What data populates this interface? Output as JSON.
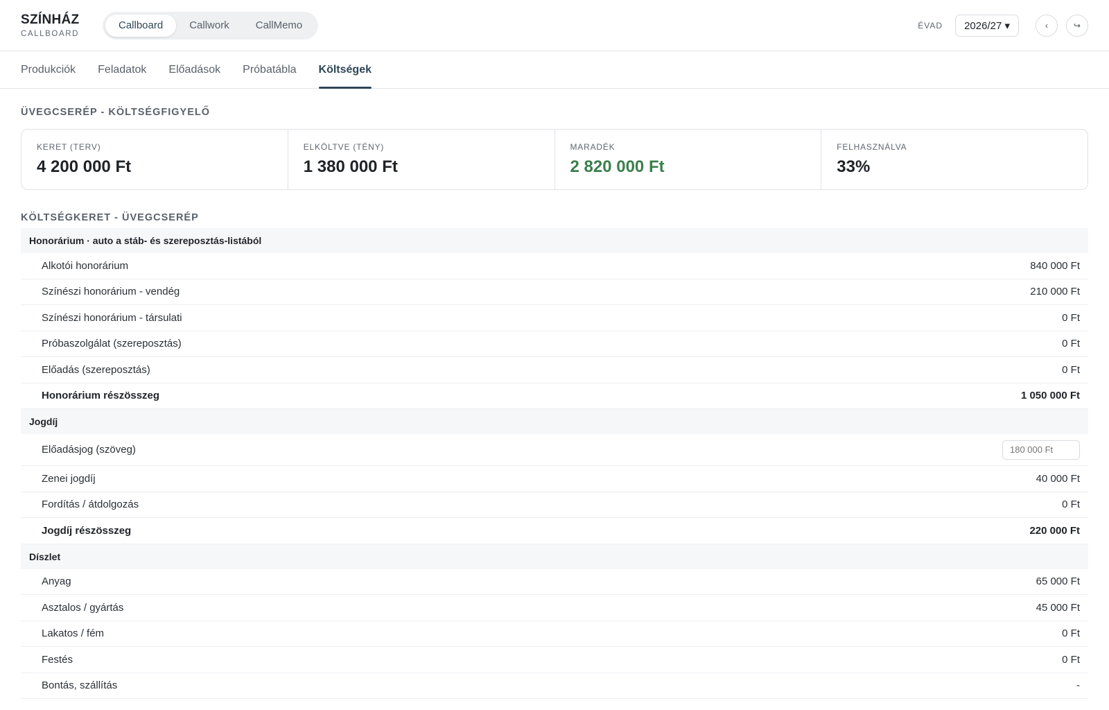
{
  "brand": {
    "title": "SZÍNHÁZ",
    "subtitle": "CALLBOARD"
  },
  "apps": [
    {
      "label": "Callboard",
      "active": true
    },
    {
      "label": "Callwork",
      "active": false
    },
    {
      "label": "CallMemo",
      "active": false
    }
  ],
  "season": {
    "label": "ÉVAD",
    "value": "2026/27 ▾"
  },
  "header_icons": {
    "back": "‹",
    "logout": "↪"
  },
  "nav": [
    {
      "label": "Produkciók",
      "active": false
    },
    {
      "label": "Feladatok",
      "active": false
    },
    {
      "label": "Előadások",
      "active": false
    },
    {
      "label": "Próbatábla",
      "active": false
    },
    {
      "label": "Költségek",
      "active": true
    }
  ],
  "page_title": "ÜVEGCSERÉP - KÖLTSÉGFIGYELŐ",
  "kpis": [
    {
      "label": "KERET (TERV)",
      "value": "4 200 000 Ft"
    },
    {
      "label": "ELKÖLTVE (TÉNY)",
      "value": "1 380 000 Ft"
    },
    {
      "label": "MARADÉK",
      "value": "2 820 000 Ft"
    },
    {
      "label": "FELHASZNÁLVA",
      "value": "33%"
    }
  ],
  "colors": {
    "accent": "#2f4757",
    "positive": "#3b7f4c"
  },
  "budget": {
    "title": "KÖLTSÉGKERET - ÜVEGCSERÉP",
    "groups": [
      {
        "label": "Honorárium · auto a stáb- és szereposztás-listából",
        "items": [
          {
            "label": "Alkotói honorárium",
            "amount": "840 000 Ft"
          },
          {
            "label": "Színészi honorárium - vendég",
            "amount": "210 000 Ft"
          },
          {
            "label": "Színészi honorárium - társulati",
            "amount": "0 Ft"
          },
          {
            "label": "Próbaszolgálat (szereposztás)",
            "amount": "0 Ft"
          },
          {
            "label": "Előadás (szereposztás)",
            "amount": "0 Ft"
          }
        ],
        "subtotal": {
          "label": "Honorárium részösszeg",
          "amount": "1 050 000 Ft"
        }
      },
      {
        "label": "Jogdíj",
        "items": [
          {
            "label": "Előadásjog (szöveg)",
            "input_placeholder": "180 000 Ft"
          },
          {
            "label": "Zenei jogdíj",
            "amount": "40 000 Ft"
          },
          {
            "label": "Fordítás / átdolgozás",
            "amount": "0 Ft"
          }
        ],
        "subtotal": {
          "label": "Jogdíj részösszeg",
          "amount": "220 000 Ft"
        }
      },
      {
        "label": "Díszlet",
        "items": [
          {
            "label": "Anyag",
            "amount": "65 000 Ft"
          },
          {
            "label": "Asztalos / gyártás",
            "amount": "45 000 Ft"
          },
          {
            "label": "Lakatos / fém",
            "amount": "0 Ft"
          },
          {
            "label": "Festés",
            "amount": "0 Ft"
          },
          {
            "label": "Bontás, szállítás",
            "amount": "-"
          }
        ]
      }
    ]
  }
}
